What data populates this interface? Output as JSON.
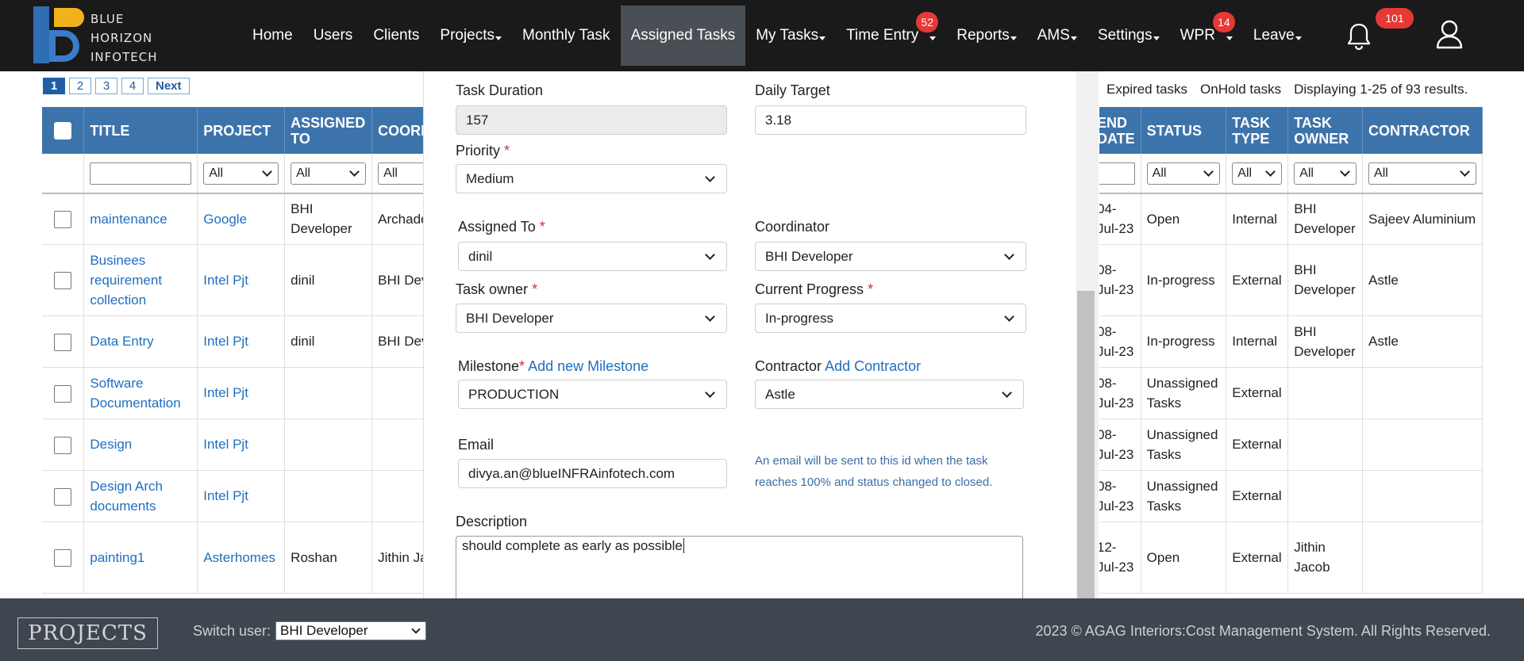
{
  "brand": {
    "lines": [
      "BLUE",
      "HORIZON",
      "INFOTECH"
    ]
  },
  "nav": [
    {
      "label": "Home",
      "dropdown": false
    },
    {
      "label": "Users",
      "dropdown": false
    },
    {
      "label": "Clients",
      "dropdown": false
    },
    {
      "label": "Projects",
      "dropdown": true
    },
    {
      "label": "Monthly Task",
      "dropdown": false
    },
    {
      "label": "Assigned Tasks",
      "dropdown": false,
      "active": true
    },
    {
      "label": "My Tasks",
      "dropdown": true
    },
    {
      "label": "Time Entry",
      "dropdown": true,
      "badge": "52"
    },
    {
      "label": "Reports",
      "dropdown": true
    },
    {
      "label": "AMS",
      "dropdown": true
    },
    {
      "label": "Settings",
      "dropdown": true
    },
    {
      "label": "WPR",
      "dropdown": true,
      "badge": "14"
    },
    {
      "label": "Leave",
      "dropdown": true
    }
  ],
  "notifications": {
    "count": "101"
  },
  "pager": {
    "pages": [
      "1",
      "2",
      "3",
      "4"
    ],
    "current": "1",
    "next": "Next"
  },
  "toolbar": {
    "expired": "Expired tasks",
    "onhold": "OnHold tasks",
    "summary": "Displaying 1-25 of 93 results."
  },
  "left_table": {
    "columns": [
      "TITLE",
      "PROJECT",
      "ASSIGNED TO",
      "COORD"
    ],
    "filter_all": "All",
    "rows": [
      {
        "title": "maintenance",
        "project": "Google",
        "assigned": "BHI Developer",
        "coord": "Archade"
      },
      {
        "title": "Businees requirement collection",
        "project": "Intel Pjt",
        "assigned": "dinil",
        "coord": "BHI Dev"
      },
      {
        "title": "Data Entry",
        "project": "Intel Pjt",
        "assigned": "dinil",
        "coord": "BHI Dev"
      },
      {
        "title": "Software Documentation",
        "project": "Intel Pjt",
        "assigned": "",
        "coord": ""
      },
      {
        "title": "Design",
        "project": "Intel Pjt",
        "assigned": "",
        "coord": ""
      },
      {
        "title": "Design Arch documents",
        "project": "Intel Pjt",
        "assigned": "",
        "coord": ""
      },
      {
        "title": "painting1",
        "project": "Asterhomes",
        "assigned": "Roshan",
        "coord": "Jithin Ja"
      }
    ]
  },
  "right_table": {
    "columns": [
      "END DATE",
      "STATUS",
      "TASK TYPE",
      "TASK OWNER",
      "CONTRACTOR"
    ],
    "filter_all": "All",
    "rows": [
      {
        "end": "04-Jul-23",
        "status": "Open",
        "type": "Internal",
        "owner": "BHI Developer",
        "contractor": "Sajeev Aluminium"
      },
      {
        "end": "08-Jul-23",
        "status": "In-progress",
        "type": "External",
        "owner": "BHI Developer",
        "contractor": "Astle"
      },
      {
        "end": "08-Jul-23",
        "status": "In-progress",
        "type": "Internal",
        "owner": "BHI Developer",
        "contractor": "Astle"
      },
      {
        "end": "08-Jul-23",
        "status": "Unassigned Tasks",
        "type": "External",
        "owner": "",
        "contractor": ""
      },
      {
        "end": "08-Jul-23",
        "status": "Unassigned Tasks",
        "type": "External",
        "owner": "",
        "contractor": ""
      },
      {
        "end": "08-Jul-23",
        "status": "Unassigned Tasks",
        "type": "External",
        "owner": "",
        "contractor": ""
      },
      {
        "end": "12-Jul-23",
        "status": "Open",
        "type": "External",
        "owner": "Jithin Jacob",
        "contractor": ""
      }
    ]
  },
  "form": {
    "task_duration": {
      "label": "Task Duration",
      "value": "157"
    },
    "daily_target": {
      "label": "Daily Target",
      "value": "3.18"
    },
    "priority": {
      "label": "Priority",
      "value": "Medium"
    },
    "assigned_to": {
      "label": "Assigned To",
      "value": "dinil"
    },
    "coordinator": {
      "label": "Coordinator",
      "value": "BHI Developer"
    },
    "task_owner": {
      "label": "Task owner",
      "value": "BHI Developer"
    },
    "current_progress": {
      "label": "Current Progress",
      "value": "In-progress"
    },
    "milestone": {
      "label": "Milestone",
      "link": "Add new Milestone",
      "value": "PRODUCTION"
    },
    "contractor": {
      "label": "Contractor",
      "link": "Add Contractor",
      "value": "Astle"
    },
    "email": {
      "label": "Email",
      "value": "divya.an@blueINFRAinfotech.com"
    },
    "email_hint": "An email will be sent to this id when the task reaches 100% and status changed to closed.",
    "description": {
      "label": "Description",
      "value": "should complete as early as possible"
    }
  },
  "footer": {
    "brand": "PROJECTS",
    "switch_label": "Switch user:",
    "switch_value": "BHI Developer",
    "copyright": "2023 © AGAG Interiors:Cost Management System. All Rights Reserved."
  }
}
